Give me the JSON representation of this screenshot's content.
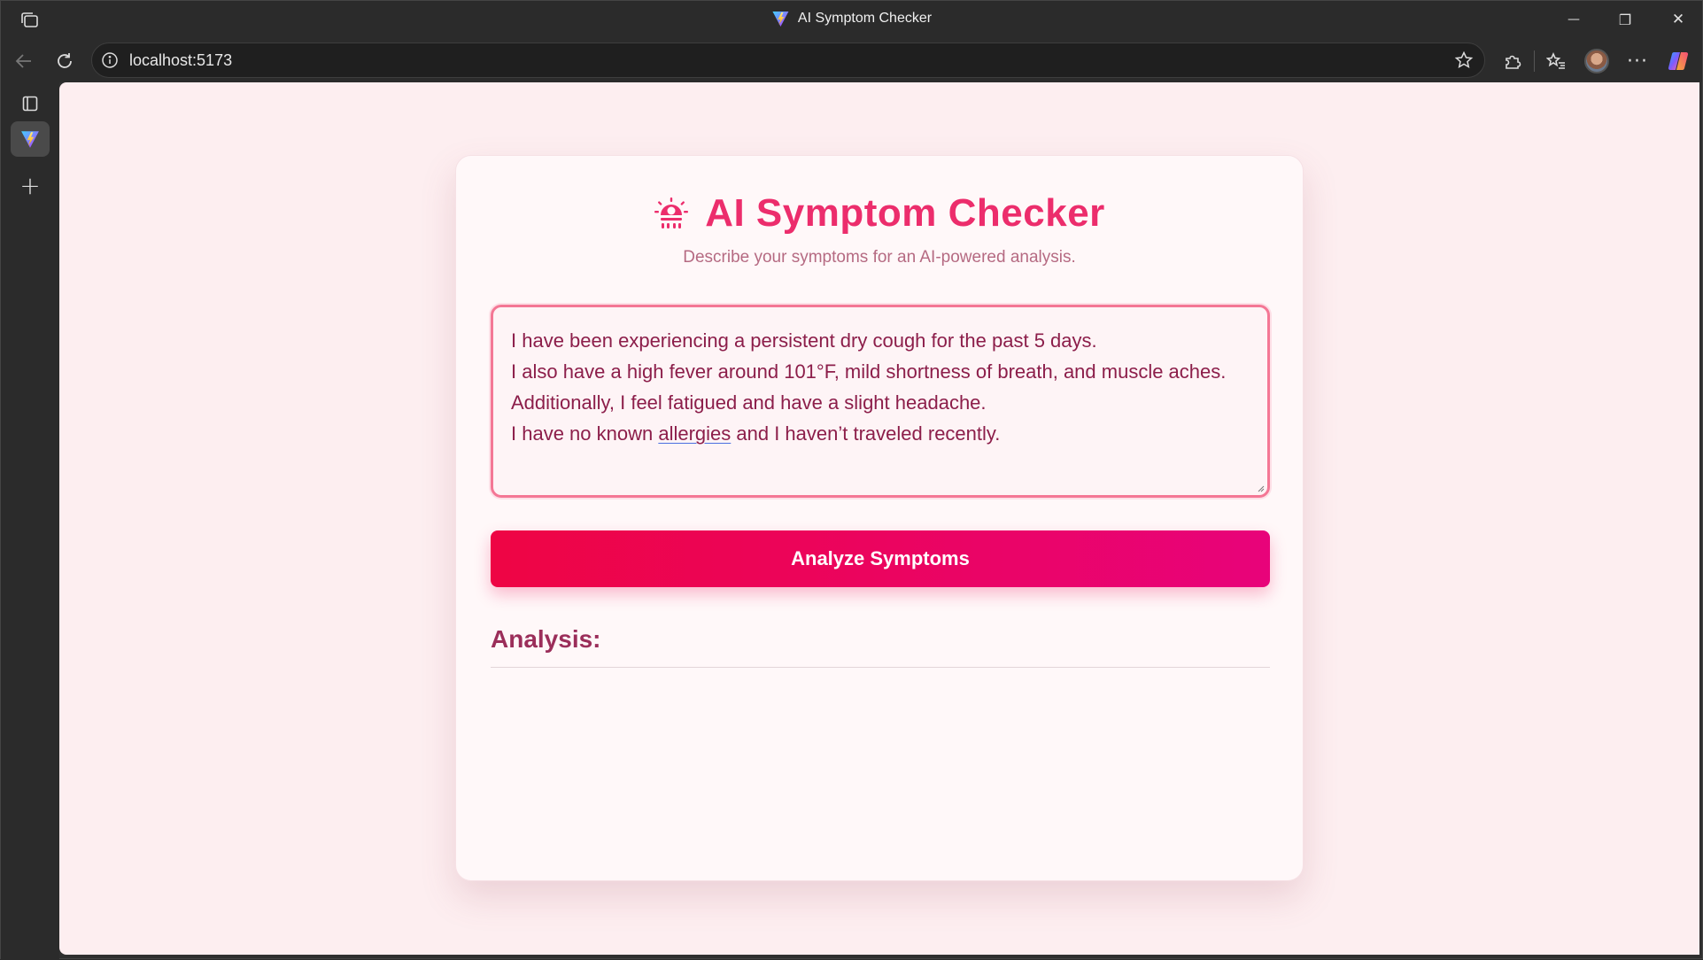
{
  "browser": {
    "window_title": "AI Symptom Checker",
    "url": "localhost:5173",
    "window_controls": {
      "minimize": "—",
      "restore": "❐",
      "close": "✕"
    },
    "more_label": "···",
    "new_tab_label": "+"
  },
  "app": {
    "title": "AI Symptom Checker",
    "subtitle": "Describe your symptoms for an AI-powered analysis.",
    "symptoms": {
      "line1": "I have been experiencing a persistent dry cough for the past 5 days.",
      "line2": "I also have a high fever around 101°F, mild shortness of breath, and muscle aches.",
      "line3": "Additionally, I feel fatigued and have a slight headache.",
      "line4_pre": "I have no known ",
      "line4_misspelled": "allergies",
      "line4_post": " and I haven’t traveled recently."
    },
    "analyze_label": "Analyze Symptoms",
    "analysis_heading": "Analysis:",
    "analysis_text": ""
  },
  "colors": {
    "accent": "#ec2d6c",
    "button_start": "#ee0544",
    "button_end": "#e8037a",
    "heading": "#9b2e5a",
    "page_bg": "#fdeef0"
  },
  "icons": {
    "title_icon": "germ-icon",
    "tab_favicon": "vite-icon"
  }
}
